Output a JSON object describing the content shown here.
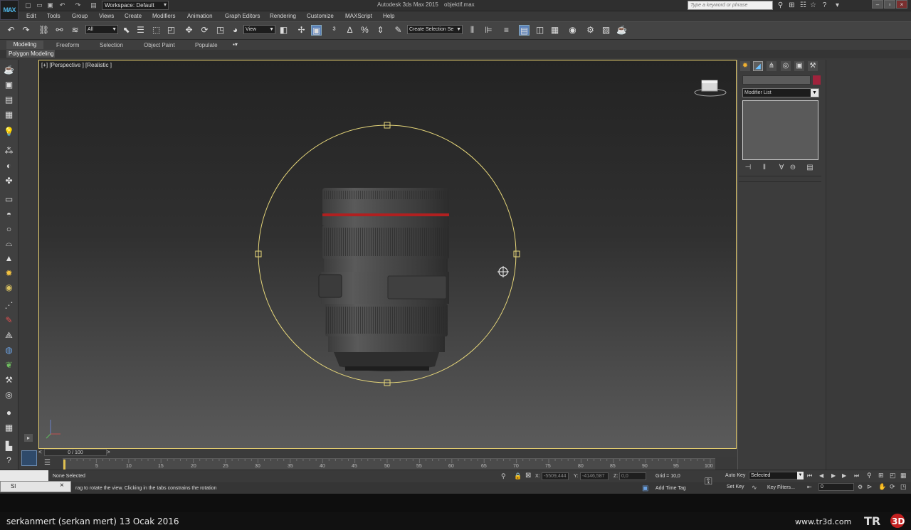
{
  "app": {
    "logo_text": "MAX",
    "logo_sub": "MAX",
    "title": "Autodesk 3ds Max  2015",
    "file": "objektif.max",
    "workspace": "Workspace: Default",
    "search_placeholder": "Type a keyword or phrase"
  },
  "menu": [
    "Edit",
    "Tools",
    "Group",
    "Views",
    "Create",
    "Modifiers",
    "Animation",
    "Graph Editors",
    "Rendering",
    "Customize",
    "MAXScript",
    "Help"
  ],
  "toolbar": {
    "filter_value": "All",
    "coord_value": "View",
    "selection_set_value": "Create Selection Se"
  },
  "ribbon": {
    "tabs": [
      "Modeling",
      "Freeform",
      "Selection",
      "Object Paint",
      "Populate"
    ],
    "panel": "Polygon Modeling"
  },
  "viewport": {
    "label": "[+] [Perspective ] [Realistic ]",
    "object": "camera-lens-model"
  },
  "command_panel": {
    "modifier_list": "Modifier List",
    "color": "#a0233c"
  },
  "timeline": {
    "frame_display": "0 / 100",
    "ticks": [
      "5",
      "10",
      "15",
      "20",
      "25",
      "30",
      "35",
      "40",
      "45",
      "50",
      "55",
      "60",
      "65",
      "70",
      "75",
      "80",
      "85",
      "90",
      "95",
      "100"
    ]
  },
  "status": {
    "selection": "None Selected",
    "hint": "rag to rotate the view.  Clicking in the tabs constrains the rotation",
    "x_label": "X:",
    "x_value": "-5509,444",
    "y_label": "Y:",
    "y_value": "-4146,587",
    "z_label": "Z:",
    "z_value": "0,0",
    "grid": "Grid = 10,0",
    "add_time_tag": "Add Time Tag",
    "auto_key": "Auto Key",
    "set_key": "Set Key",
    "key_mode_value": "Selected",
    "key_filters": "Key Filters...",
    "frame_field": "0",
    "maxscript_label": "Sl"
  },
  "footer": {
    "author": "serkanmert (serkan mert)  13 Ocak 2016",
    "site": "www.tr3d.com",
    "logo_text": "TR3D"
  }
}
